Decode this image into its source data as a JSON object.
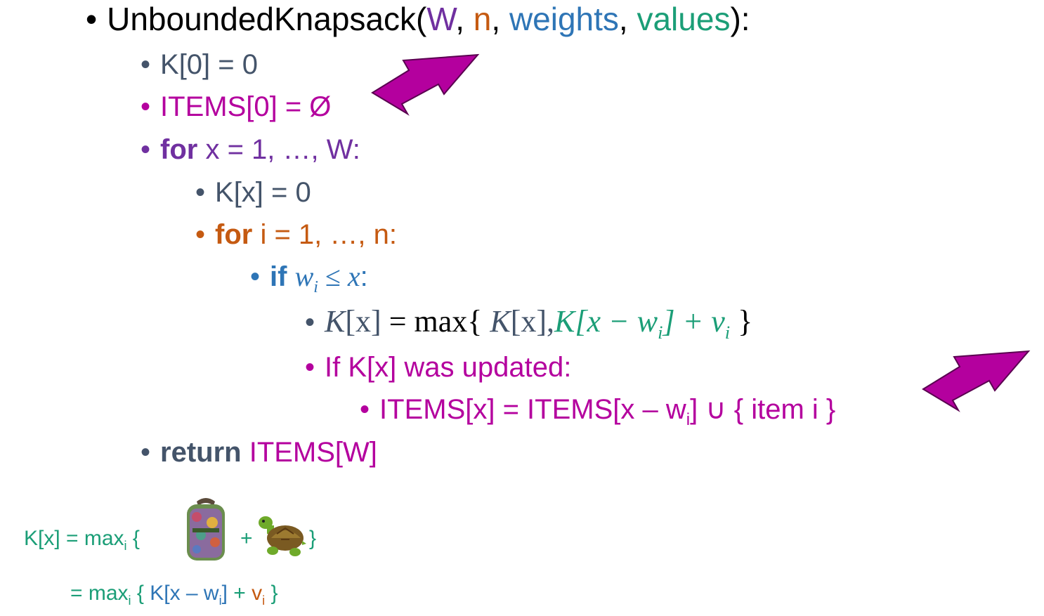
{
  "colors": {
    "dark": "#44546a",
    "purple": "#7030a0",
    "orange": "#c55a11",
    "blue": "#2e75b6",
    "teal": "#1b9e77",
    "magenta": "#b4009e",
    "arrow": "#b4009e"
  },
  "title": {
    "bullet": "•",
    "fn": "UnboundedKnapsack(",
    "arg_W": "W",
    "sep1": ", ",
    "arg_n": "n",
    "sep2": ", ",
    "arg_weights": "weights",
    "sep3": ", ",
    "arg_values": "values",
    "close": "):"
  },
  "lines": {
    "k0": "K[0] = 0",
    "items0": "ITEMS[0] = Ø",
    "for_x_kw": "for",
    "for_x_rest": " x = 1, …, W:",
    "kx0": "K[x] = 0",
    "for_i_kw": "for",
    "for_i_rest": " i = 1, …, n:",
    "if_kw": "if",
    "if_w": "w",
    "if_sub": "i",
    "if_rest": " ≤ ",
    "if_x": "x",
    "if_colon": ":",
    "update_lhs": "K",
    "update_lhs_idx": "[x]",
    "update_eq": " = max{ ",
    "update_mid": "K",
    "update_mid_idx": "[x],",
    "update_term": "K[x  − w",
    "update_term_sub": "i",
    "update_term_close": "] + v",
    "update_term_sub2": "i",
    "update_close": " }",
    "if_updated": "If K[x] was updated:",
    "items_x_pre": "ITEMS[x] = ITEMS[x – w",
    "items_x_sub": "i",
    "items_x_post": "] ∪ { item i }",
    "return_kw": "return",
    "return_val": " ITEMS[W]"
  },
  "footnote": {
    "line1_pre": "K[x] = max",
    "line1_sub": "i",
    "line1_open": " {",
    "line1_plus": "+",
    "line1_close": "}",
    "backpack_icon": "backpack-icon",
    "turtle_icon": "turtle-icon",
    "line2_pre": "= max",
    "line2_sub": "i",
    "line2_open": " { ",
    "line2_k": "K[x – w",
    "line2_wsub": "i",
    "line2_k_close": "]",
    "line2_plus": " + ",
    "line2_v": "v",
    "line2_vsub": "i",
    "line2_close": " }"
  }
}
